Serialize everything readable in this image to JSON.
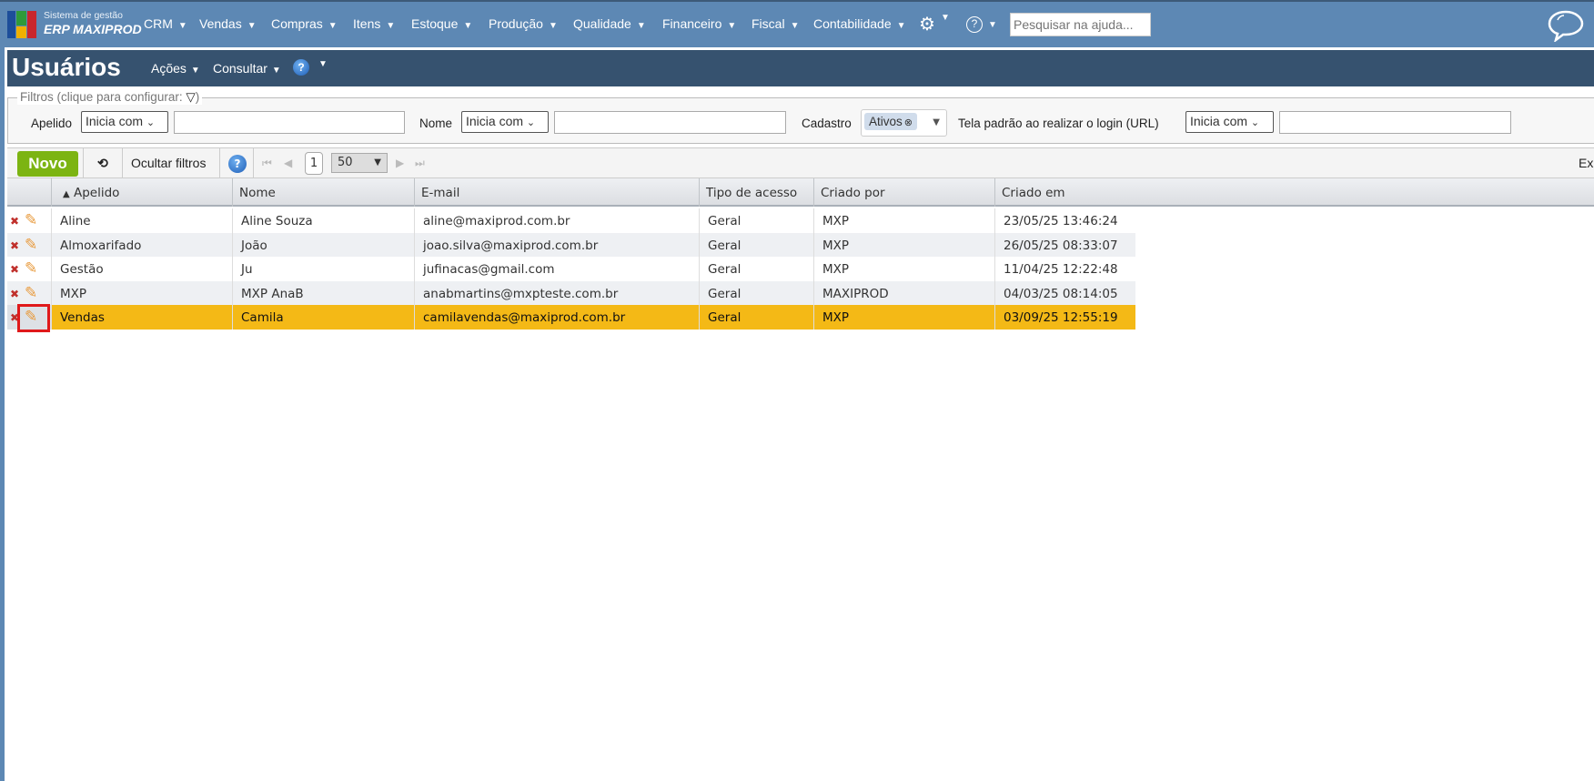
{
  "app": {
    "logo_line1": "Sistema de gestão",
    "logo_line2": "ERP MAXIPROD"
  },
  "menu": [
    "CRM",
    "Vendas",
    "Compras",
    "Itens",
    "Estoque",
    "Produção",
    "Qualidade",
    "Financeiro",
    "Fiscal",
    "Contabilidade"
  ],
  "search": {
    "placeholder": "Pesquisar na ajuda..."
  },
  "page": {
    "title": "Usuários",
    "actions_label": "Ações",
    "consult_label": "Consultar"
  },
  "filters": {
    "legend": "Filtros (clique para configurar:",
    "legend_end": ")",
    "apelido_label": "Apelido",
    "apelido_op": "Inicia com",
    "nome_label": "Nome",
    "nome_op": "Inicia com",
    "cadastro_label": "Cadastro",
    "cadastro_tag": "Ativos",
    "tela_label": "Tela padrão ao realizar o login (URL)",
    "tela_op": "Inicia com"
  },
  "toolbar": {
    "new_label": "Novo",
    "hide_filters_label": "Ocultar filtros",
    "page": "1",
    "per_page": "50",
    "export_label": "Ex"
  },
  "table": {
    "columns": [
      "Apelido",
      "Nome",
      "E-mail",
      "Tipo de acesso",
      "Criado por",
      "Criado em"
    ],
    "rows": [
      [
        "Aline",
        "Aline Souza",
        "aline@maxiprod.com.br",
        "Geral",
        "MXP",
        "23/05/25 13:46:24"
      ],
      [
        "Almoxarifado",
        "João",
        "joao.silva@maxiprod.com.br",
        "Geral",
        "MXP",
        "26/05/25 08:33:07"
      ],
      [
        "Gestão",
        "Ju",
        "jufinacas@gmail.com",
        "Geral",
        "MXP",
        "11/04/25 12:22:48"
      ],
      [
        "MXP",
        "MXP AnaB",
        "anabmartins@mxpteste.com.br",
        "Geral",
        "MAXIPROD",
        "04/03/25 08:14:05"
      ],
      [
        "Vendas",
        "Camila",
        "camilavendas@maxiprod.com.br",
        "Geral",
        "MXP",
        "03/09/25 12:55:19"
      ]
    ],
    "selected_row": 4
  },
  "colors": {
    "topbar": "#5d88b4",
    "titlebar": "#36526f",
    "selected": "#f4b916",
    "new_button": "#7cb412"
  }
}
